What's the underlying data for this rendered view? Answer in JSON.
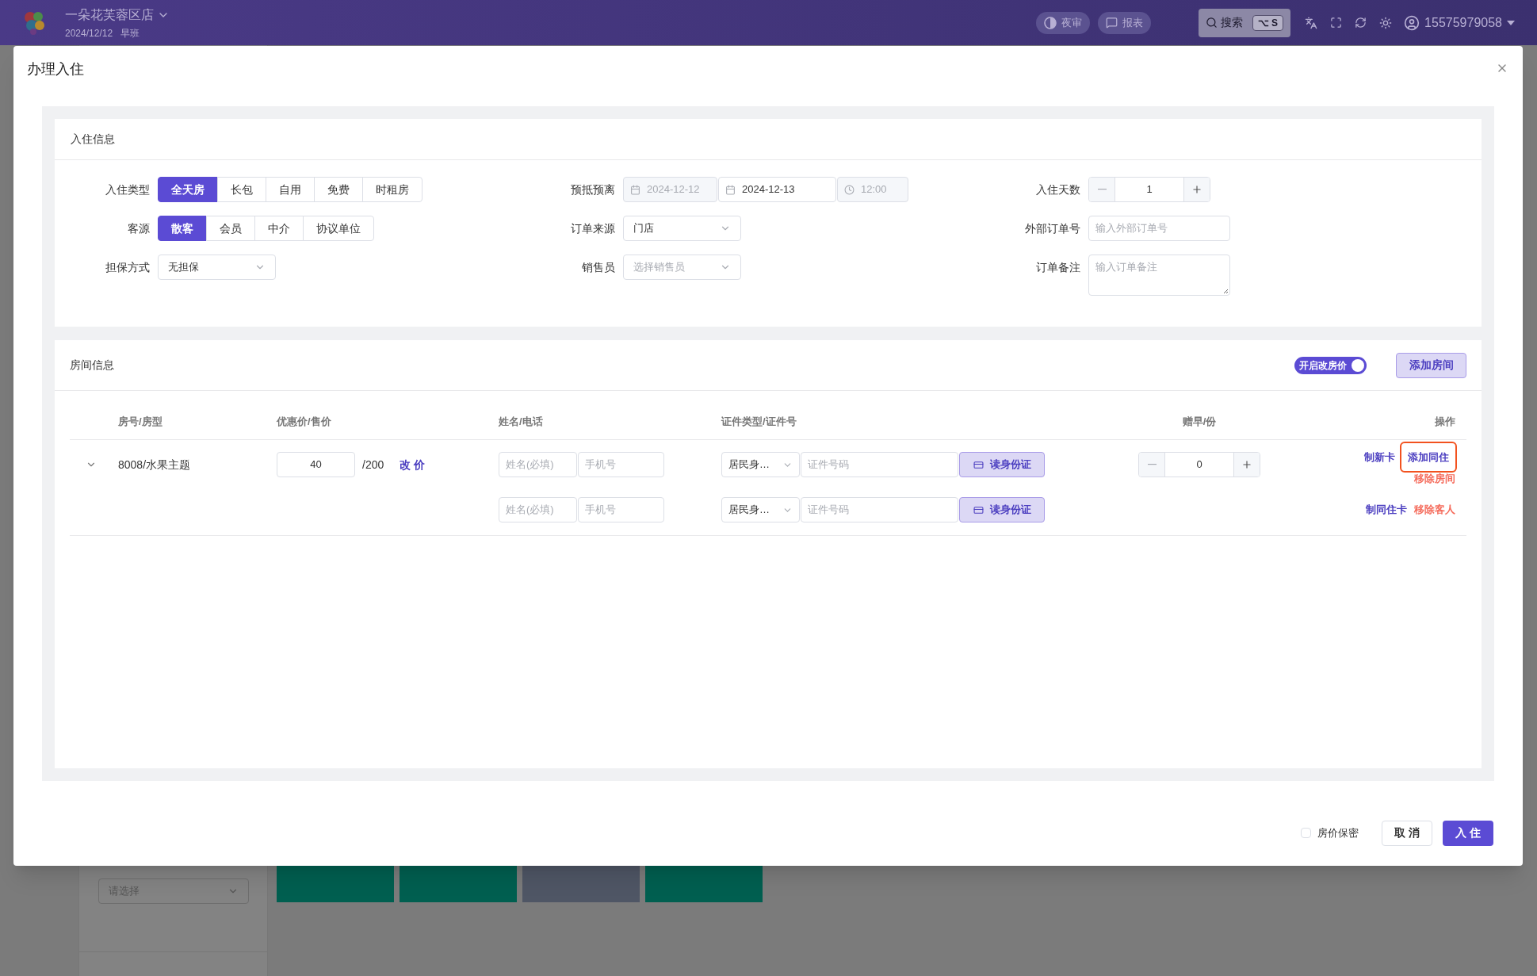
{
  "topbar": {
    "store_name": "一朵花芙蓉区店",
    "date": "2024/12/12",
    "shift": "早班",
    "buttons": [
      {
        "label": "夜审",
        "kind": "audit"
      },
      {
        "label": "报表",
        "kind": "report"
      }
    ],
    "search": {
      "label": "搜索",
      "shortcut": "⌥ S"
    },
    "user": "15575979058"
  },
  "background": {
    "select_placeholder": "请选择",
    "tiles": [
      {
        "color": "#005f50"
      },
      {
        "color": "#005f50"
      },
      {
        "color": "#4f5665"
      },
      {
        "color": "#005f50"
      }
    ]
  },
  "dialog": {
    "title": "办理入住",
    "checkin_info": {
      "title": "入住信息",
      "columns": [
        [
          {
            "kind": "segmented",
            "label": "入住类型",
            "options": [
              {
                "label": "全天房",
                "selected": true
              },
              {
                "label": "长包",
                "selected": false
              },
              {
                "label": "自用",
                "selected": false
              },
              {
                "label": "免费",
                "selected": false
              },
              {
                "label": "时租房",
                "selected": false
              }
            ]
          },
          {
            "kind": "segmented",
            "label": "客源",
            "options": [
              {
                "label": "散客",
                "selected": true
              },
              {
                "label": "会员",
                "selected": false
              },
              {
                "label": "中介",
                "selected": false
              },
              {
                "label": "协议单位",
                "selected": false
              }
            ]
          },
          {
            "kind": "select",
            "label": "担保方式",
            "value": "无担保"
          }
        ],
        [
          {
            "kind": "date_range",
            "label": "预抵预离",
            "start": {
              "value": "2024-12-12",
              "disabled": true
            },
            "end": {
              "value": "2024-12-13",
              "disabled": false
            },
            "time": {
              "value": "12:00",
              "disabled": true
            }
          },
          {
            "kind": "select",
            "label": "订单来源",
            "value": "门店"
          },
          {
            "kind": "select",
            "label": "销售员",
            "placeholder": "选择销售员"
          }
        ],
        [
          {
            "kind": "stepper",
            "label": "入住天数",
            "value": "1"
          },
          {
            "kind": "input",
            "label": "外部订单号",
            "placeholder": "输入外部订单号"
          },
          {
            "kind": "textarea",
            "label": "订单备注",
            "placeholder": "输入订单备注"
          }
        ]
      ]
    },
    "room_info": {
      "title": "房间信息",
      "toggle": {
        "label": "开启改房价",
        "on": true
      },
      "add_button": "添加房间",
      "columns": [
        "房号/房型",
        "优惠价/售价",
        "姓名/电话",
        "证件类型/证件号",
        "赠早/份",
        "操作"
      ],
      "rows": [
        {
          "kind": "room",
          "expanded": true,
          "room": "8008/水果主题",
          "price": "40",
          "sale_price": "/200",
          "change_price": "改 价",
          "name_placeholder": "姓名(必填)",
          "phone_placeholder": "手机号",
          "id_type": "居民身…",
          "id_placeholder": "证件号码",
          "read_id": "读身份证",
          "breakfast": "0",
          "actions": [
            {
              "label": "制新卡",
              "kind": "primary",
              "highlighted": false
            },
            {
              "label": "添加同住",
              "kind": "primary",
              "highlighted": true
            },
            {
              "label": "移除房间",
              "kind": "danger",
              "highlighted": false
            }
          ]
        },
        {
          "kind": "guest",
          "name_placeholder": "姓名(必填)",
          "phone_placeholder": "手机号",
          "id_type": "居民身…",
          "id_placeholder": "证件号码",
          "read_id": "读身份证",
          "actions": [
            {
              "label": "制同住卡",
              "kind": "primary",
              "highlighted": false
            },
            {
              "label": "移除客人",
              "kind": "danger",
              "highlighted": false
            }
          ]
        }
      ]
    },
    "footer": {
      "confidential": {
        "label": "房价保密",
        "checked": false
      },
      "cancel": "取 消",
      "confirm": "入 住"
    }
  }
}
